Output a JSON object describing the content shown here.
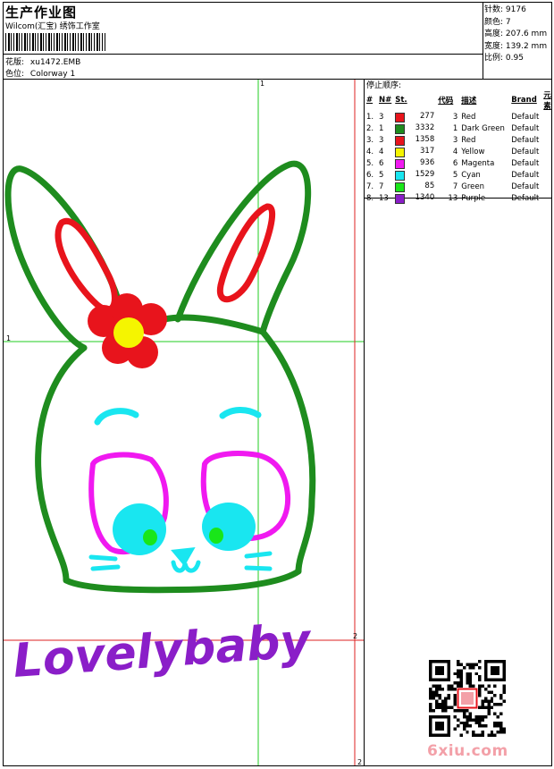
{
  "header": {
    "title": "生产作业图",
    "company": "Wilcom(汇宝) 绣饰工作室",
    "design_label": "花版:",
    "design_file": "xu1472.EMB",
    "colorway_label": "色位:",
    "colorway": "Colorway 1"
  },
  "stats": [
    {
      "label": "针数:",
      "value": "9176"
    },
    {
      "label": "颜色:",
      "value": "7"
    },
    {
      "label": "高度:",
      "value": "207.6 mm"
    },
    {
      "label": "宽度:",
      "value": "139.2 mm"
    },
    {
      "label": "比例:",
      "value": "0.95"
    }
  ],
  "stop_sequence": {
    "title": "停止顺序:",
    "columns": [
      "#",
      "N#",
      "St.",
      "代码",
      "描述",
      "Brand",
      "元素"
    ],
    "rows": [
      {
        "idx": "1.",
        "n": "3",
        "color": "#e8141c",
        "st": "277",
        "code": "3",
        "desc": "Red",
        "brand": "Default"
      },
      {
        "idx": "2.",
        "n": "1",
        "color": "#1e8c1e",
        "st": "3332",
        "code": "1",
        "desc": "Dark Green",
        "brand": "Default"
      },
      {
        "idx": "3.",
        "n": "3",
        "color": "#e8141c",
        "st": "1358",
        "code": "3",
        "desc": "Red",
        "brand": "Default"
      },
      {
        "idx": "4.",
        "n": "4",
        "color": "#f5f500",
        "st": "317",
        "code": "4",
        "desc": "Yellow",
        "brand": "Default"
      },
      {
        "idx": "5.",
        "n": "6",
        "color": "#f019f0",
        "st": "936",
        "code": "6",
        "desc": "Magenta",
        "brand": "Default"
      },
      {
        "idx": "6.",
        "n": "5",
        "color": "#19e6f0",
        "st": "1529",
        "code": "5",
        "desc": "Cyan",
        "brand": "Default"
      },
      {
        "idx": "7.",
        "n": "7",
        "color": "#19e619",
        "st": "85",
        "code": "7",
        "desc": "Green",
        "brand": "Default"
      },
      {
        "idx": "8.",
        "n": "13",
        "color": "#8a1ec8",
        "st": "1340",
        "code": "13",
        "desc": "Purple",
        "brand": "Default"
      }
    ]
  },
  "guides": {
    "g1": "1",
    "g2": "2"
  },
  "design": {
    "text": "Lovelybaby"
  },
  "watermark": "6xiu.com"
}
